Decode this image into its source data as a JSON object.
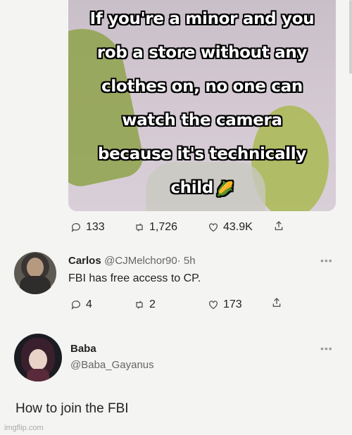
{
  "meme": {
    "lines": [
      "If you're a minor and you",
      "rob a store without any",
      "clothes on, no one can",
      "watch the camera",
      "because it's technically",
      "child"
    ],
    "emoji": "🌽"
  },
  "tweet1": {
    "stats": {
      "replies": "133",
      "retweets": "1,726",
      "likes": "43.9K"
    }
  },
  "reply1": {
    "name": "Carlos",
    "handle": "@CJMelchor90",
    "time": "· 5h",
    "text": "FBI has free access to CP.",
    "stats": {
      "replies": "4",
      "retweets": "2",
      "likes": "173"
    }
  },
  "reply2": {
    "name": "Baba",
    "handle": "@Baba_Gayanus",
    "text": "How to join the FBI"
  },
  "more_label": "•••",
  "watermark": "imgflip.com"
}
